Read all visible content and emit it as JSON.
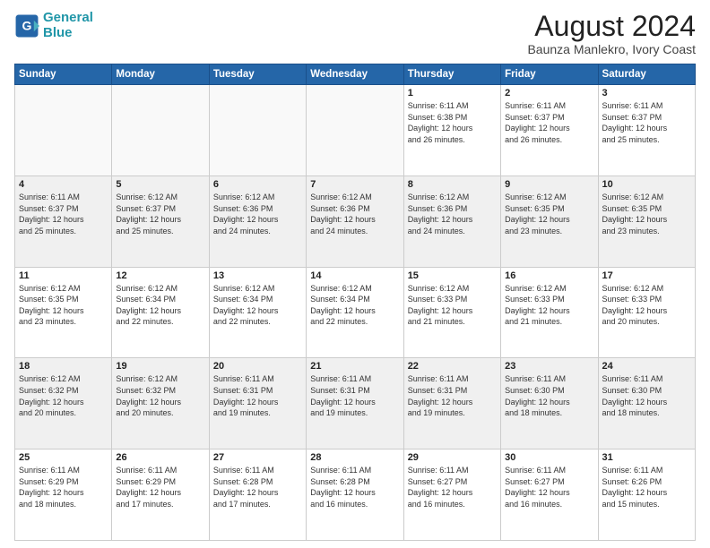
{
  "header": {
    "logo_general": "General",
    "logo_blue": "Blue",
    "title": "August 2024",
    "subtitle": "Baunza Manlekro, Ivory Coast"
  },
  "days_of_week": [
    "Sunday",
    "Monday",
    "Tuesday",
    "Wednesday",
    "Thursday",
    "Friday",
    "Saturday"
  ],
  "weeks": [
    {
      "alt": false,
      "days": [
        {
          "num": "",
          "info": ""
        },
        {
          "num": "",
          "info": ""
        },
        {
          "num": "",
          "info": ""
        },
        {
          "num": "",
          "info": ""
        },
        {
          "num": "1",
          "info": "Sunrise: 6:11 AM\nSunset: 6:38 PM\nDaylight: 12 hours\nand 26 minutes."
        },
        {
          "num": "2",
          "info": "Sunrise: 6:11 AM\nSunset: 6:37 PM\nDaylight: 12 hours\nand 26 minutes."
        },
        {
          "num": "3",
          "info": "Sunrise: 6:11 AM\nSunset: 6:37 PM\nDaylight: 12 hours\nand 25 minutes."
        }
      ]
    },
    {
      "alt": true,
      "days": [
        {
          "num": "4",
          "info": "Sunrise: 6:11 AM\nSunset: 6:37 PM\nDaylight: 12 hours\nand 25 minutes."
        },
        {
          "num": "5",
          "info": "Sunrise: 6:12 AM\nSunset: 6:37 PM\nDaylight: 12 hours\nand 25 minutes."
        },
        {
          "num": "6",
          "info": "Sunrise: 6:12 AM\nSunset: 6:36 PM\nDaylight: 12 hours\nand 24 minutes."
        },
        {
          "num": "7",
          "info": "Sunrise: 6:12 AM\nSunset: 6:36 PM\nDaylight: 12 hours\nand 24 minutes."
        },
        {
          "num": "8",
          "info": "Sunrise: 6:12 AM\nSunset: 6:36 PM\nDaylight: 12 hours\nand 24 minutes."
        },
        {
          "num": "9",
          "info": "Sunrise: 6:12 AM\nSunset: 6:35 PM\nDaylight: 12 hours\nand 23 minutes."
        },
        {
          "num": "10",
          "info": "Sunrise: 6:12 AM\nSunset: 6:35 PM\nDaylight: 12 hours\nand 23 minutes."
        }
      ]
    },
    {
      "alt": false,
      "days": [
        {
          "num": "11",
          "info": "Sunrise: 6:12 AM\nSunset: 6:35 PM\nDaylight: 12 hours\nand 23 minutes."
        },
        {
          "num": "12",
          "info": "Sunrise: 6:12 AM\nSunset: 6:34 PM\nDaylight: 12 hours\nand 22 minutes."
        },
        {
          "num": "13",
          "info": "Sunrise: 6:12 AM\nSunset: 6:34 PM\nDaylight: 12 hours\nand 22 minutes."
        },
        {
          "num": "14",
          "info": "Sunrise: 6:12 AM\nSunset: 6:34 PM\nDaylight: 12 hours\nand 22 minutes."
        },
        {
          "num": "15",
          "info": "Sunrise: 6:12 AM\nSunset: 6:33 PM\nDaylight: 12 hours\nand 21 minutes."
        },
        {
          "num": "16",
          "info": "Sunrise: 6:12 AM\nSunset: 6:33 PM\nDaylight: 12 hours\nand 21 minutes."
        },
        {
          "num": "17",
          "info": "Sunrise: 6:12 AM\nSunset: 6:33 PM\nDaylight: 12 hours\nand 20 minutes."
        }
      ]
    },
    {
      "alt": true,
      "days": [
        {
          "num": "18",
          "info": "Sunrise: 6:12 AM\nSunset: 6:32 PM\nDaylight: 12 hours\nand 20 minutes."
        },
        {
          "num": "19",
          "info": "Sunrise: 6:12 AM\nSunset: 6:32 PM\nDaylight: 12 hours\nand 20 minutes."
        },
        {
          "num": "20",
          "info": "Sunrise: 6:11 AM\nSunset: 6:31 PM\nDaylight: 12 hours\nand 19 minutes."
        },
        {
          "num": "21",
          "info": "Sunrise: 6:11 AM\nSunset: 6:31 PM\nDaylight: 12 hours\nand 19 minutes."
        },
        {
          "num": "22",
          "info": "Sunrise: 6:11 AM\nSunset: 6:31 PM\nDaylight: 12 hours\nand 19 minutes."
        },
        {
          "num": "23",
          "info": "Sunrise: 6:11 AM\nSunset: 6:30 PM\nDaylight: 12 hours\nand 18 minutes."
        },
        {
          "num": "24",
          "info": "Sunrise: 6:11 AM\nSunset: 6:30 PM\nDaylight: 12 hours\nand 18 minutes."
        }
      ]
    },
    {
      "alt": false,
      "days": [
        {
          "num": "25",
          "info": "Sunrise: 6:11 AM\nSunset: 6:29 PM\nDaylight: 12 hours\nand 18 minutes."
        },
        {
          "num": "26",
          "info": "Sunrise: 6:11 AM\nSunset: 6:29 PM\nDaylight: 12 hours\nand 17 minutes."
        },
        {
          "num": "27",
          "info": "Sunrise: 6:11 AM\nSunset: 6:28 PM\nDaylight: 12 hours\nand 17 minutes."
        },
        {
          "num": "28",
          "info": "Sunrise: 6:11 AM\nSunset: 6:28 PM\nDaylight: 12 hours\nand 16 minutes."
        },
        {
          "num": "29",
          "info": "Sunrise: 6:11 AM\nSunset: 6:27 PM\nDaylight: 12 hours\nand 16 minutes."
        },
        {
          "num": "30",
          "info": "Sunrise: 6:11 AM\nSunset: 6:27 PM\nDaylight: 12 hours\nand 16 minutes."
        },
        {
          "num": "31",
          "info": "Sunrise: 6:11 AM\nSunset: 6:26 PM\nDaylight: 12 hours\nand 15 minutes."
        }
      ]
    }
  ]
}
